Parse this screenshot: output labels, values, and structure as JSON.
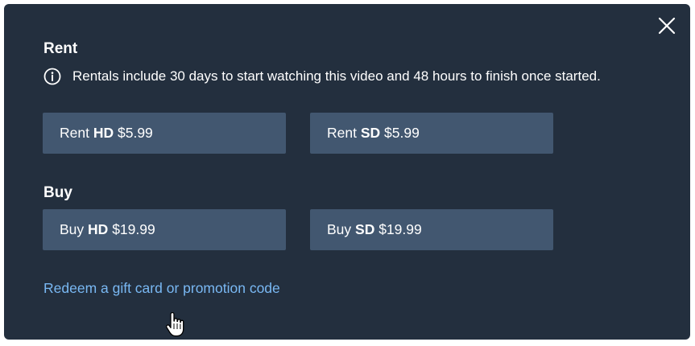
{
  "modal": {
    "close_icon": "close-x-icon",
    "rent": {
      "title": "Rent",
      "info_icon": "info-circle-icon",
      "info_text": "Rentals include 30 days to start watching this video and 48 hours to finish once started.",
      "options": [
        {
          "prefix": "Rent",
          "quality": "HD",
          "price": "$5.99"
        },
        {
          "prefix": "Rent",
          "quality": "SD",
          "price": "$5.99"
        }
      ]
    },
    "buy": {
      "title": "Buy",
      "options": [
        {
          "prefix": "Buy",
          "quality": "HD",
          "price": "$19.99"
        },
        {
          "prefix": "Buy",
          "quality": "SD",
          "price": "$19.99"
        }
      ]
    },
    "redeem_link": "Redeem a gift card or promotion code"
  },
  "colors": {
    "modal_bg": "#232f3e",
    "button_bg": "#425770",
    "link": "#79b8f3",
    "text": "#ffffff"
  },
  "cursor_icon": "hand-pointer-icon"
}
